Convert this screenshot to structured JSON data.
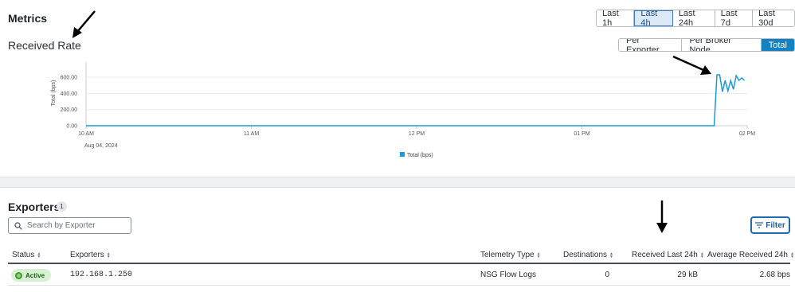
{
  "header": {
    "title": "Metrics",
    "subtitle": "Received Rate"
  },
  "time_range": {
    "options": [
      "Last 1h",
      "Last 4h",
      "Last 24h",
      "Last 7d",
      "Last 30d"
    ],
    "selected": "Last 4h"
  },
  "view_mode": {
    "options": [
      "Per Exporter",
      "Per Broker Node",
      "Total"
    ],
    "selected": "Total"
  },
  "chart_data": {
    "type": "line",
    "ylabel": "Total (bps)",
    "ylim": [
      0,
      600
    ],
    "y_ticks": [
      "0.00",
      "200.00",
      "400.00",
      "600.00"
    ],
    "x_ticks": [
      "10 AM",
      "11 AM",
      "12 PM",
      "01 PM",
      "02 PM"
    ],
    "x_date_label": "Aug 04, 2024",
    "grid": true,
    "legend_position": "bottom",
    "series": [
      {
        "name": "Total (bps)",
        "color": "#1a9bd7",
        "x": [
          "10:00",
          "10:30",
          "11:00",
          "11:30",
          "12:00",
          "12:30",
          "13:00",
          "13:30",
          "13:48",
          "13:49",
          "13:50",
          "13:51",
          "13:52",
          "13:53",
          "13:54",
          "13:55",
          "13:56",
          "13:57",
          "13:58",
          "13:59"
        ],
        "values": [
          0,
          0,
          0,
          0,
          0,
          0,
          0,
          0,
          0,
          630,
          630,
          420,
          560,
          430,
          560,
          450,
          620,
          560,
          590,
          560
        ]
      }
    ]
  },
  "exporters": {
    "title": "Exporters",
    "count": "1",
    "search_placeholder": "Search by Exporter",
    "filter_label": "Filter",
    "columns": {
      "status": "Status",
      "exporters": "Exporters",
      "telemetry_type": "Telemetry Type",
      "destinations": "Destinations",
      "received_last_24h": "Received Last 24h",
      "average_received_24h": "Average Received 24h"
    },
    "rows": [
      {
        "status": "Active",
        "exporter": "192.168.1.250",
        "telemetry_type": "NSG Flow Logs",
        "destinations": "0",
        "received_last_24h": "29 kB",
        "average_received_24h": "2.68 bps"
      }
    ]
  },
  "colors": {
    "accent": "#1481c1",
    "active_status": "#3f9a30",
    "series": "#1a9bd7"
  }
}
